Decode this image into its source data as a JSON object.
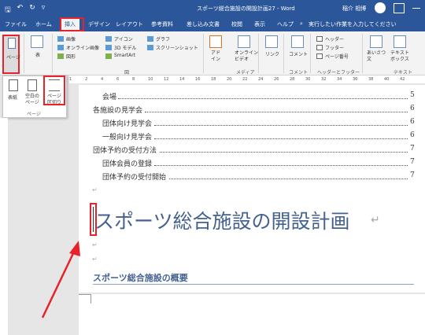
{
  "window": {
    "title": "スポーツ総合施設の開設計画27 - Word",
    "user": "稲介 相博",
    "qat_icons": [
      "save-icon",
      "undo-icon",
      "redo-icon",
      "customize-icon"
    ]
  },
  "tabs": [
    {
      "label": "ファイル"
    },
    {
      "label": "ホーム"
    },
    {
      "label": "挿入",
      "active": true
    },
    {
      "label": "デザイン"
    },
    {
      "label": "レイアウト"
    },
    {
      "label": "参考資料"
    },
    {
      "label": "差し込み文書"
    },
    {
      "label": "校閲"
    },
    {
      "label": "表示"
    },
    {
      "label": "ヘルプ"
    },
    {
      "label": "実行したい作業を入力してください"
    }
  ],
  "ribbon": {
    "pages_label": "ページ",
    "table_label": "表",
    "illustrations": {
      "image": "画像",
      "online_image": "オンライン画像",
      "shapes": "図形",
      "icons": "アイコン",
      "model3d": "3D モデル",
      "smartart": "SmartArt",
      "graph": "グラフ",
      "screenshot": "スクリーンショット",
      "group": "図"
    },
    "addins_label": "アド\nイン",
    "online_video": "オンライン\nビデオ",
    "media_group": "メディア",
    "link_label": "リンク",
    "comment_label": "コメント",
    "comment_group": "コメント",
    "header": "ヘッダー",
    "footer": "フッター",
    "page_number": "ページ番号",
    "header_footer_group": "ヘッダーとフッター",
    "greeting": "あいさつ\n文",
    "textbox": "テキスト\nボックス",
    "text_group": "テキスト"
  },
  "page_dropdown": {
    "cover": "表紙",
    "blank_page": "空白の\nページ",
    "page_break": "ページ\n区切り",
    "group": "ページ"
  },
  "ruler_marks": [
    "1",
    "2",
    "4",
    "6",
    "8",
    "10",
    "12",
    "14",
    "16",
    "18",
    "20",
    "22",
    "24",
    "26",
    "28",
    "30",
    "32",
    "34",
    "36",
    "38",
    "40",
    "42"
  ],
  "toc": [
    {
      "text": "会場",
      "page": "5",
      "indent": 2
    },
    {
      "text": "各施設の見学会",
      "page": "6",
      "indent": 1
    },
    {
      "text": "団体向け見学会",
      "page": "6",
      "indent": 2
    },
    {
      "text": "一般向け見学会",
      "page": "6",
      "indent": 2
    },
    {
      "text": "団体予約の受付方法",
      "page": "7",
      "indent": 1
    },
    {
      "text": "団体会員の登録",
      "page": "7",
      "indent": 2
    },
    {
      "text": "団体予約の受付開始",
      "page": "7",
      "indent": 2
    }
  ],
  "heading1": "スポーツ総合施設の開設計画",
  "heading2": "スポーツ総合施設の概要",
  "para_mark": "↵",
  "colors": {
    "title_bar": "#2b579a",
    "highlight": "#e8222a",
    "heading": "#44618f"
  }
}
